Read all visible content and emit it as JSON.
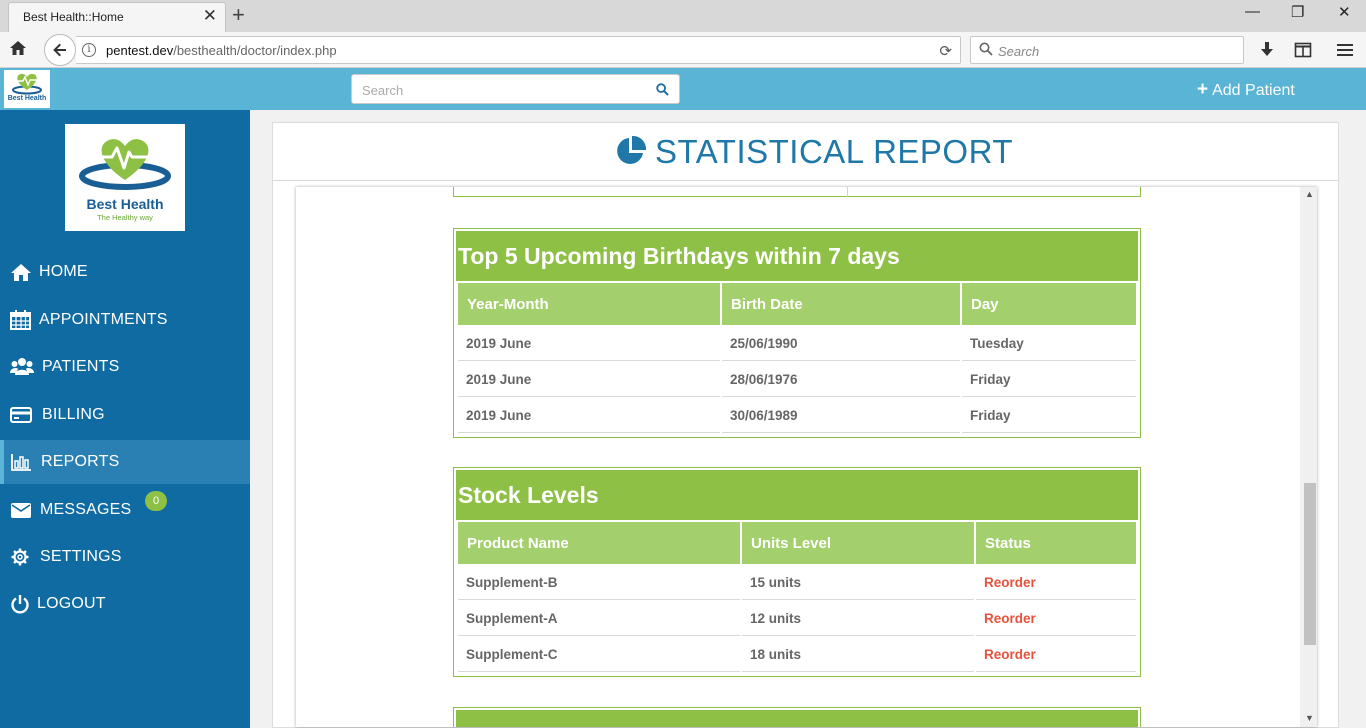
{
  "browser": {
    "tab_title": "Best Health::Home",
    "url_host": "pentest.dev",
    "url_path": "/besthealth/doctor/index.php",
    "search_placeholder": "Search"
  },
  "header": {
    "brand_mini": "Best Health",
    "search_placeholder": "Search",
    "add_patient_label": "Add Patient"
  },
  "sidebar": {
    "logo_name": "Best Health",
    "logo_tagline": "The Healthy way",
    "items": [
      {
        "label": "HOME",
        "icon": "home-icon"
      },
      {
        "label": "APPOINTMENTS",
        "icon": "calendar-icon"
      },
      {
        "label": "PATIENTS",
        "icon": "users-icon"
      },
      {
        "label": "BILLING",
        "icon": "credit-card-icon"
      },
      {
        "label": "REPORTS",
        "icon": "bar-chart-icon",
        "active": true
      },
      {
        "label": "MESSAGES",
        "icon": "envelope-icon",
        "badge": "0"
      },
      {
        "label": "SETTINGS",
        "icon": "gear-icon"
      },
      {
        "label": "LOGOUT",
        "icon": "power-icon"
      }
    ]
  },
  "report": {
    "title": "STATISTICAL REPORT",
    "birthdays": {
      "title": "Top 5 Upcoming Birthdays within 7 days",
      "columns": [
        "Year-Month",
        "Birth Date",
        "Day"
      ],
      "rows": [
        [
          "2019 June",
          "25/06/1990",
          "Tuesday"
        ],
        [
          "2019 June",
          "28/06/1976",
          "Friday"
        ],
        [
          "2019 June",
          "30/06/1989",
          "Friday"
        ]
      ]
    },
    "stock": {
      "title": "Stock Levels",
      "columns": [
        "Product Name",
        "Units Level",
        "Status"
      ],
      "rows": [
        [
          "Supplement-B",
          "15 units",
          "Reorder"
        ],
        [
          "Supplement-A",
          "12 units",
          "Reorder"
        ],
        [
          "Supplement-C",
          "18 units",
          "Reorder"
        ]
      ]
    }
  },
  "colors": {
    "sidebar": "#0f6ba2",
    "header": "#5ab4d6",
    "green": "#8dc044",
    "reorder": "#e8513b"
  }
}
